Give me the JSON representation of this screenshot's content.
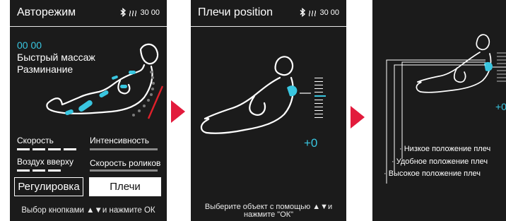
{
  "screen1": {
    "title": "Авторежим",
    "time": "30 00",
    "timer": "00 00",
    "program_line1": "Быстрый массаж",
    "program_line2": "Разминание",
    "speed_label": "Скорость",
    "intensity_label": "Интенсивность",
    "air_label": "Воздух вверху",
    "roller_speed_label": "Скорость роликов",
    "adjust_button": "Регулировка",
    "shoulders_button": "Плечи",
    "footer": "Выбор кнопками ▲▼и нажмите ОК"
  },
  "screen2": {
    "title": "Плечи position",
    "time": "30 00",
    "value": "+0",
    "footer_line1": "Выберите объект с помощью ▲▼и",
    "footer_line2": "нажмите \"ОК\""
  },
  "screen3": {
    "value": "+0",
    "label_low": "Низкое положение плеч",
    "label_comfort": "Удобное положение плеч",
    "label_high": "Высокое положение плеч"
  },
  "colors": {
    "accent": "#39c6e0",
    "arrow": "#e21b3c",
    "alert": "#e0202a"
  },
  "icons": [
    "bluetooth-icon",
    "heat-icon",
    "next-arrow-icon"
  ]
}
